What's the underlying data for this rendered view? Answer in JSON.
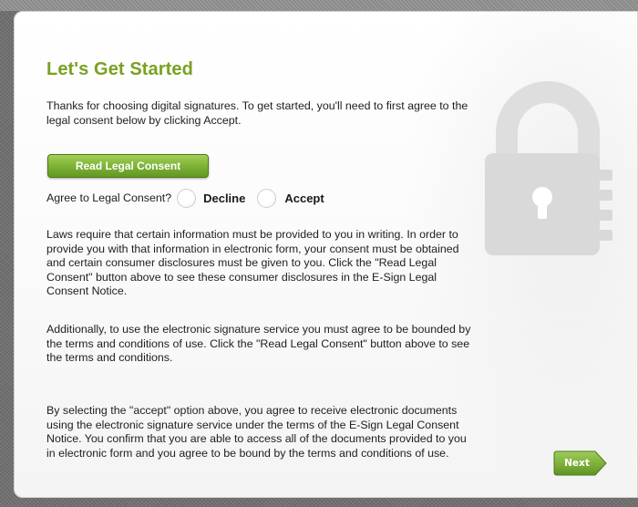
{
  "dialog": {
    "title": "Let's Get Started",
    "intro": "Thanks for choosing digital signatures. To get started, you'll need to first agree to the legal consent below by clicking Accept.",
    "read_button_label": "Read Legal Consent",
    "consent_question": "Agree to Legal Consent?",
    "options": {
      "decline": "Decline",
      "accept": "Accept"
    },
    "paragraphs": [
      "Laws require that certain information must be provided to you in writing. In order to provide you with that information in electronic form, your consent must be obtained and certain consumer disclosures must be given to you. Click the \"Read Legal Consent\" button above to see these consumer disclosures in the E-Sign Legal Consent Notice.",
      "Additionally, to use the electronic signature service you must agree to be bounded by the terms and conditions of use. Click the \"Read Legal Consent\" button above to see the terms and conditions.",
      "By selecting the \"accept\" option above, you agree to receive electronic documents using the electronic signature service under the terms of the E-Sign Legal Consent Notice. You confirm that you are able to access all of the documents provided to you in electronic form and you agree to be bound by the terms and conditions of use."
    ],
    "next_label": "Next",
    "lock_icon": "padlock-icon",
    "colors": {
      "accent": "#7aa121",
      "button_green": "#7eb337",
      "next_green": "#75aa34",
      "lock_gray": "#d9d9d9"
    }
  }
}
